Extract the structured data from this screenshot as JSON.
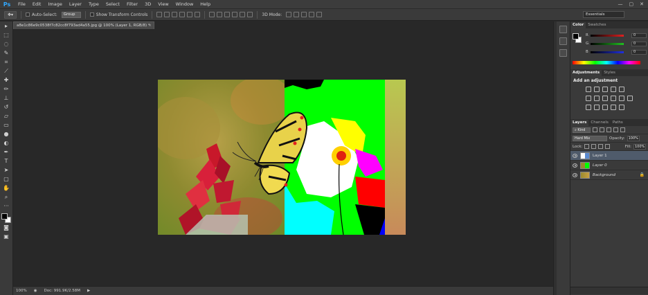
{
  "app": {
    "logo": "Ps"
  },
  "menu": [
    "File",
    "Edit",
    "Image",
    "Layer",
    "Type",
    "Select",
    "Filter",
    "3D",
    "View",
    "Window",
    "Help"
  ],
  "window_controls": [
    "—",
    "▢",
    "✕"
  ],
  "options_bar": {
    "auto_select_label": "Auto-Select:",
    "auto_select_value": "Group",
    "show_transform_label": "Show Transform Controls",
    "mode_3d_label": "3D Mode:",
    "workspace": "Essentials"
  },
  "document": {
    "tab_title": "a8e1c86e9c0538f7c82cc8f793ad4a55.jpg @ 100% (Layer 1, RGB/8) *",
    "close": "×",
    "zoom": "100%",
    "doc_info": "Doc: 991.9K/2.58M"
  },
  "color_panel": {
    "tabs": [
      "Color",
      "Swatches"
    ],
    "channels": [
      {
        "label": "R",
        "value": "0",
        "color": "#e02020"
      },
      {
        "label": "G",
        "value": "0",
        "color": "#20c020"
      },
      {
        "label": "B",
        "value": "0",
        "color": "#2030e0"
      }
    ]
  },
  "adjustments_panel": {
    "tabs": [
      "Adjustments",
      "Styles"
    ],
    "title": "Add an adjustment"
  },
  "layers_panel": {
    "tabs": [
      "Layers",
      "Channels",
      "Paths"
    ],
    "filter": "Kind",
    "blend_mode": "Hard Mix",
    "opacity_label": "Opacity:",
    "opacity_value": "100%",
    "lock_label": "Lock:",
    "fill_label": "Fill:",
    "fill_value": "100%",
    "layers": [
      {
        "name": "Layer 1",
        "selected": true,
        "italic": false
      },
      {
        "name": "Layer 0",
        "selected": false,
        "italic": true
      },
      {
        "name": "Background",
        "selected": false,
        "italic": true,
        "locked": true
      }
    ]
  },
  "colors": {
    "bright_green": "#00ff00",
    "cyan": "#00ffff",
    "magenta": "#ff00ff",
    "red": "#ff0000",
    "yellow": "#ffff00"
  }
}
